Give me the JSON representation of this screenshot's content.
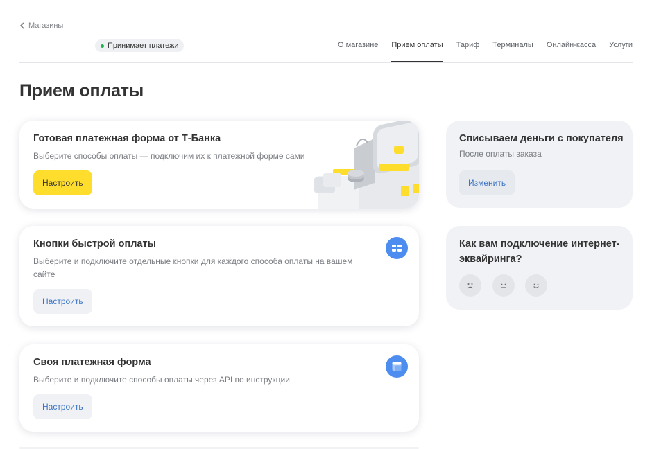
{
  "nav": {
    "back_label": "Магазины",
    "status_label": "Принимает платежи",
    "status_color": "#22b14c",
    "tabs": [
      {
        "label": "О магазине"
      },
      {
        "label": "Прием оплаты"
      },
      {
        "label": "Тариф"
      },
      {
        "label": "Терминалы"
      },
      {
        "label": "Онлайн-касса"
      },
      {
        "label": "Услуги"
      }
    ],
    "active_tab": "Прием оплаты"
  },
  "page": {
    "title": "Прием оплаты"
  },
  "cards": [
    {
      "title": "Готовая платежная форма от Т-Банка",
      "description": "Выберите способы оплаты — подключим их к платежной форме сами",
      "button": "Настроить",
      "icon": "payment-form-illustration"
    },
    {
      "title": "Кнопки быстрой оплаты",
      "description": "Выберите и подключите отдельные кнопки для каждого способа оплаты на вашем сайте",
      "button": "Настроить",
      "icon": "grid-icon"
    },
    {
      "title": "Своя платежная форма",
      "description": "Выберите и подключите способы оплаты через API по инструкции",
      "button": "Настроить",
      "icon": "window-icon"
    }
  ],
  "side": {
    "charge": {
      "title": "Списываем деньги с покупателя",
      "subtitle": "После оплаты заказа",
      "button": "Изменить"
    },
    "feedback": {
      "title": "Как вам подключение интернет-эквайринга?",
      "options": [
        "sad-face-icon",
        "neutral-face-icon",
        "happy-face-icon"
      ]
    }
  },
  "colors": {
    "accent_yellow": "#ffdd2d",
    "link_blue": "#3973c7",
    "icon_blue": "#4d8df0"
  }
}
